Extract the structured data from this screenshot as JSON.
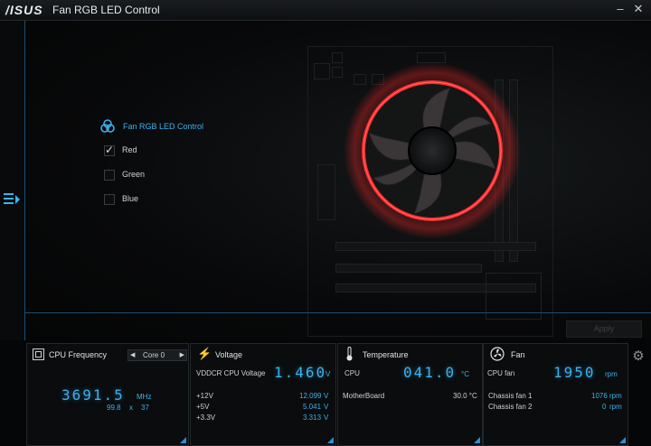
{
  "app": {
    "brand": "/ISUS",
    "title": "Fan RGB LED Control"
  },
  "window_buttons": {
    "minimize": "–",
    "close": "✕"
  },
  "led_control": {
    "title": "Fan RGB LED Control",
    "options": [
      {
        "label": "Red",
        "checked": true
      },
      {
        "label": "Green",
        "checked": false
      },
      {
        "label": "Blue",
        "checked": false
      }
    ],
    "apply_label": "Apply"
  },
  "cpu_frequency": {
    "title": "CPU Frequency",
    "core_selected": "Core 0",
    "value": "3691.5",
    "unit": "MHz",
    "multiplier_base": "99.8",
    "multiplier_sep": "x",
    "multiplier_ratio": "37"
  },
  "voltage": {
    "title": "Voltage",
    "main_label": "VDDCR CPU Voltage",
    "main_value": "1.460",
    "main_unit": "V",
    "rows": [
      {
        "label": "+12V",
        "value": "12.099",
        "unit": "V"
      },
      {
        "label": "+5V",
        "value": "5.041",
        "unit": "V"
      },
      {
        "label": "+3.3V",
        "value": "3.313",
        "unit": "V"
      }
    ]
  },
  "temperature": {
    "title": "Temperature",
    "main_label": "CPU",
    "main_value": "041.0",
    "main_unit": "°C",
    "rows": [
      {
        "label": "MotherBoard",
        "value": "30.0 °C"
      }
    ]
  },
  "fan": {
    "title": "Fan",
    "main_label": "CPU fan",
    "main_value": "1950",
    "main_unit": "rpm",
    "rows": [
      {
        "label": "Chassis fan 1",
        "value": "1076",
        "unit": "rpm"
      },
      {
        "label": "Chassis fan 2",
        "value": "0",
        "unit": "rpm"
      }
    ]
  },
  "colors": {
    "accent": "#3bb2ef",
    "ring": "#ff2a2a"
  },
  "icons": [
    "menu-expand-icon",
    "rgb-icon",
    "cpu-icon",
    "voltage-icon",
    "thermometer-icon",
    "fan-icon",
    "gear-icon"
  ]
}
